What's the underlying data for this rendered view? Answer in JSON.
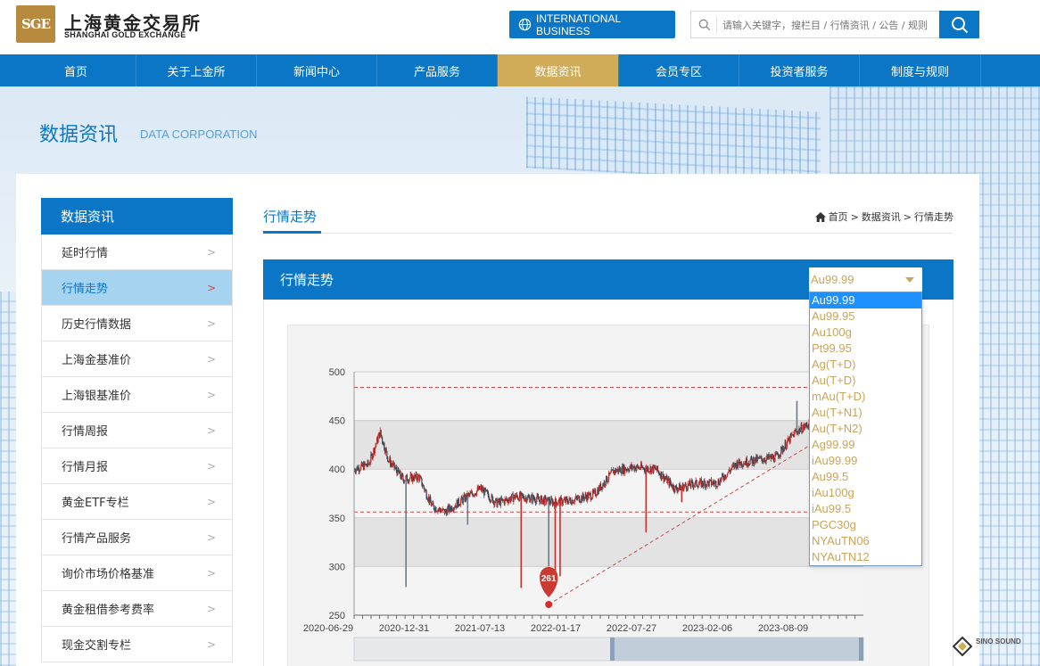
{
  "header": {
    "logo_mark": "SGE",
    "logo_cn": "上海黄金交易所",
    "logo_en": "SHANGHAI GOLD EXCHANGE",
    "intl_button": "INTERNATIONAL BUSINESS",
    "search_placeholder": "请输入关键字，搜栏目 / 行情资讯 / 公告 / 规则"
  },
  "nav": {
    "items": [
      {
        "label": "首页"
      },
      {
        "label": "关于上金所"
      },
      {
        "label": "新闻中心"
      },
      {
        "label": "产品服务"
      },
      {
        "label": "数据资讯",
        "active": true
      },
      {
        "label": "会员专区"
      },
      {
        "label": "投资者服务"
      },
      {
        "label": "制度与规则"
      }
    ]
  },
  "banner": {
    "title": "数据资讯",
    "subtitle": "DATA CORPORATION"
  },
  "sidebar": {
    "title": "数据资讯",
    "items": [
      {
        "label": "延时行情"
      },
      {
        "label": "行情走势",
        "active": true
      },
      {
        "label": "历史行情数据"
      },
      {
        "label": "上海金基准价"
      },
      {
        "label": "上海银基准价"
      },
      {
        "label": "行情周报"
      },
      {
        "label": "行情月报"
      },
      {
        "label": "黄金ETF专栏"
      },
      {
        "label": "行情产品服务"
      },
      {
        "label": "询价市场价格基准"
      },
      {
        "label": "黄金租借参考费率"
      },
      {
        "label": "现金交割专栏"
      }
    ]
  },
  "main": {
    "section_title": "行情走势",
    "breadcrumb": [
      "首页",
      "数据资讯",
      "行情走势"
    ],
    "panel_title": "行情走势",
    "select": {
      "selected": "Au99.99",
      "options": [
        "Au99.99",
        "Au99.95",
        "Au100g",
        "Pt99.95",
        "Ag(T+D)",
        "Au(T+D)",
        "mAu(T+D)",
        "Au(T+N1)",
        "Au(T+N2)",
        "Ag99.99",
        "iAu99.99",
        "Au99.5",
        "iAu100g",
        "iAu99.5",
        "PGC30g",
        "NYAuTN06",
        "NYAuTN12"
      ]
    }
  },
  "colors": {
    "brand": "#0b76c5",
    "active_nav": "#d0ab58",
    "up": "#c9302c",
    "down": "#2f4554",
    "option_text": "#caa45a"
  },
  "chart_data": {
    "type": "candlestick",
    "ylim": [
      250,
      500
    ],
    "yticks": [
      250,
      300,
      350,
      400,
      450,
      500
    ],
    "x_tick_labels": [
      "2020-06-29",
      "2020-12-31",
      "2021-07-13",
      "2022-01-17",
      "2022-07-27",
      "2023-02-06",
      "2023-08-09"
    ],
    "close_series": [
      {
        "x": 0,
        "y": 400
      },
      {
        "x": 0.9,
        "y": 405
      },
      {
        "x": 1.6,
        "y": 438
      },
      {
        "x": 2.1,
        "y": 410
      },
      {
        "x": 3.0,
        "y": 390
      },
      {
        "x": 4.0,
        "y": 392
      },
      {
        "x": 4.8,
        "y": 362
      },
      {
        "x": 5.6,
        "y": 356
      },
      {
        "x": 6.8,
        "y": 370
      },
      {
        "x": 7.8,
        "y": 380
      },
      {
        "x": 8.8,
        "y": 365
      },
      {
        "x": 10.0,
        "y": 372
      },
      {
        "x": 11.0,
        "y": 370
      },
      {
        "x": 12.3,
        "y": 366
      },
      {
        "x": 13.4,
        "y": 368
      },
      {
        "x": 14.8,
        "y": 374
      },
      {
        "x": 16.0,
        "y": 398
      },
      {
        "x": 17.2,
        "y": 402
      },
      {
        "x": 18.6,
        "y": 400
      },
      {
        "x": 19.8,
        "y": 380
      },
      {
        "x": 21.0,
        "y": 385
      },
      {
        "x": 22.4,
        "y": 386
      },
      {
        "x": 23.6,
        "y": 406
      },
      {
        "x": 25.0,
        "y": 410
      },
      {
        "x": 26.0,
        "y": 412
      },
      {
        "x": 27.2,
        "y": 438
      },
      {
        "x": 28.4,
        "y": 450
      },
      {
        "x": 29.6,
        "y": 456
      },
      {
        "x": 30.6,
        "y": 460
      },
      {
        "x": 31.4,
        "y": 458
      }
    ],
    "min_marker": {
      "label": "261",
      "value": 261
    },
    "ref_lines": [
      484,
      356
    ],
    "spikes": [
      {
        "x": 3.2,
        "low": 279,
        "dir": "down"
      },
      {
        "x": 7.0,
        "low": 343,
        "dir": "down"
      },
      {
        "x": 10.3,
        "low": 278,
        "dir": "up"
      },
      {
        "x": 12.0,
        "low": 300,
        "dir": "down"
      },
      {
        "x": 12.4,
        "low": 280,
        "dir": "up"
      },
      {
        "x": 12.7,
        "low": 290,
        "dir": "up"
      },
      {
        "x": 18.0,
        "low": 335,
        "dir": "up"
      },
      {
        "x": 20.2,
        "low": 366,
        "dir": "up"
      },
      {
        "x": 29.9,
        "high": 495,
        "dir": "down"
      },
      {
        "x": 27.3,
        "high": 470,
        "dir": "down"
      }
    ]
  }
}
